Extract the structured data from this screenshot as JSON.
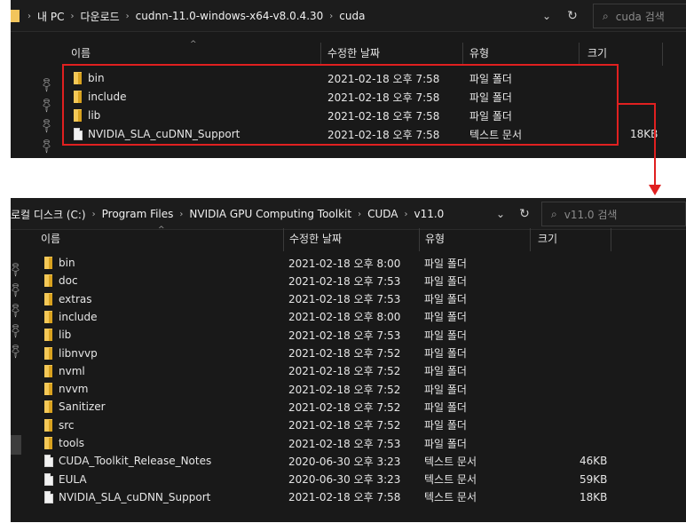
{
  "window1": {
    "breadcrumb": [
      "내 PC",
      "다운로드",
      "cudnn-11.0-windows-x64-v8.0.4.30",
      "cuda"
    ],
    "search_placeholder": "cuda 검색",
    "columns": {
      "name": "이름",
      "date": "수정한 날짜",
      "type": "유형",
      "size": "크기"
    },
    "rows": [
      {
        "kind": "folder",
        "name": "bin",
        "date": "2021-02-18 오후 7:58",
        "type": "파일 폴더",
        "size": ""
      },
      {
        "kind": "folder",
        "name": "include",
        "date": "2021-02-18 오후 7:58",
        "type": "파일 폴더",
        "size": ""
      },
      {
        "kind": "folder",
        "name": "lib",
        "date": "2021-02-18 오후 7:58",
        "type": "파일 폴더",
        "size": ""
      },
      {
        "kind": "file",
        "name": "NVIDIA_SLA_cuDNN_Support",
        "date": "2021-02-18 오후 7:58",
        "type": "텍스트 문서",
        "size": "18KB"
      }
    ]
  },
  "window2": {
    "breadcrumb": [
      "로컬 디스크 (C:)",
      "Program Files",
      "NVIDIA GPU Computing Toolkit",
      "CUDA",
      "v11.0"
    ],
    "search_placeholder": "v11.0 검색",
    "columns": {
      "name": "이름",
      "date": "수정한 날짜",
      "type": "유형",
      "size": "크기"
    },
    "rows": [
      {
        "kind": "folder",
        "name": "bin",
        "date": "2021-02-18 오후 8:00",
        "type": "파일 폴더",
        "size": ""
      },
      {
        "kind": "folder",
        "name": "doc",
        "date": "2021-02-18 오후 7:53",
        "type": "파일 폴더",
        "size": ""
      },
      {
        "kind": "folder",
        "name": "extras",
        "date": "2021-02-18 오후 7:53",
        "type": "파일 폴더",
        "size": ""
      },
      {
        "kind": "folder",
        "name": "include",
        "date": "2021-02-18 오후 8:00",
        "type": "파일 폴더",
        "size": ""
      },
      {
        "kind": "folder",
        "name": "lib",
        "date": "2021-02-18 오후 7:53",
        "type": "파일 폴더",
        "size": ""
      },
      {
        "kind": "folder",
        "name": "libnvvp",
        "date": "2021-02-18 오후 7:52",
        "type": "파일 폴더",
        "size": ""
      },
      {
        "kind": "folder",
        "name": "nvml",
        "date": "2021-02-18 오후 7:52",
        "type": "파일 폴더",
        "size": ""
      },
      {
        "kind": "folder",
        "name": "nvvm",
        "date": "2021-02-18 오후 7:52",
        "type": "파일 폴더",
        "size": ""
      },
      {
        "kind": "folder",
        "name": "Sanitizer",
        "date": "2021-02-18 오후 7:52",
        "type": "파일 폴더",
        "size": ""
      },
      {
        "kind": "folder",
        "name": "src",
        "date": "2021-02-18 오후 7:52",
        "type": "파일 폴더",
        "size": ""
      },
      {
        "kind": "folder",
        "name": "tools",
        "date": "2021-02-18 오후 7:53",
        "type": "파일 폴더",
        "size": ""
      },
      {
        "kind": "file",
        "name": "CUDA_Toolkit_Release_Notes",
        "date": "2020-06-30 오후 3:23",
        "type": "텍스트 문서",
        "size": "46KB"
      },
      {
        "kind": "file",
        "name": "EULA",
        "date": "2020-06-30 오후 3:23",
        "type": "텍스트 문서",
        "size": "59KB"
      },
      {
        "kind": "file",
        "name": "NVIDIA_SLA_cuDNN_Support",
        "date": "2021-02-18 오후 7:58",
        "type": "텍스트 문서",
        "size": "18KB"
      }
    ]
  },
  "icons": {
    "breadcrumb_separator": "chevron-right-icon",
    "dropdown": "chevron-down-icon",
    "refresh": "refresh-icon",
    "search": "search-icon",
    "pin": "pin-icon",
    "folder": "folder-icon",
    "file": "text-file-icon",
    "sort": "sort-up-icon"
  },
  "annotation": {
    "highlight_color": "#e02020"
  }
}
